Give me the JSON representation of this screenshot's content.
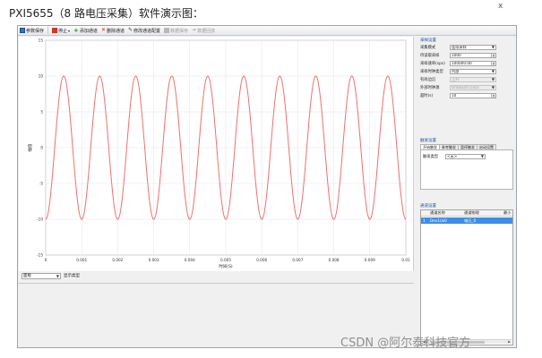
{
  "page_heading": "PXI5655（8 路电压采集）软件演示图：",
  "close_glyph": "x",
  "toolbar": {
    "items": [
      {
        "label": "参数保存",
        "icon": "save-icon"
      },
      {
        "label": "停止",
        "icon": "stop-icon"
      },
      {
        "label": "添加通道",
        "icon": "plus-icon"
      },
      {
        "label": "删除通道",
        "icon": "delete-icon"
      },
      {
        "label": "修改通道配置",
        "icon": "edit-icon"
      },
      {
        "label": "数据保存",
        "icon": "save-disabled-icon"
      },
      {
        "label": "数据回放",
        "icon": "playback-icon"
      }
    ]
  },
  "chart_data": {
    "type": "line",
    "title": "",
    "xlabel": "时间(S)",
    "ylabel": "幅值",
    "xlim": [
      0,
      0.01
    ],
    "ylim": [
      -15,
      15
    ],
    "x_ticks": [
      "0",
      "0.001",
      "0.002",
      "0.003",
      "0.004",
      "0.005",
      "0.006",
      "0.007",
      "0.008",
      "0.009",
      "0.01"
    ],
    "y_ticks": [
      "-15",
      "-10",
      "-5",
      "0",
      "5",
      "10",
      "15"
    ],
    "grid": true,
    "series": [
      {
        "amplitude": 10,
        "frequency_hz": 1000,
        "phase": "-cos",
        "color": "#f07070"
      }
    ]
  },
  "bottom_controls": {
    "select_value": "面板",
    "label": "显示类型"
  },
  "side_panel": {
    "section1_title": "采样设置",
    "rows": [
      {
        "label": "采集模式",
        "value": "连续采样",
        "type": "select",
        "disabled": false
      },
      {
        "label": "待读取采样",
        "value": "1000",
        "type": "spin",
        "disabled": false
      },
      {
        "label": "采样速率(sps)",
        "value": "100000.00",
        "type": "spin",
        "disabled": false
      },
      {
        "label": "采样时钟类型",
        "value": "内部",
        "type": "select",
        "disabled": false
      },
      {
        "label": "有效边沿",
        "value": "上升",
        "type": "select",
        "disabled": true
      },
      {
        "label": "外部时钟源",
        "value": "Onboard Clock",
        "type": "select",
        "disabled": true
      },
      {
        "label": "超时(s)",
        "value": "10",
        "type": "spin",
        "disabled": false
      }
    ],
    "section2_title": "触发设置",
    "tabs": [
      "开始触发",
      "参考触发",
      "暂停触发",
      "启动设置"
    ],
    "trigger_type_label": "触发类型",
    "trigger_type_value": "<无>",
    "section3_title": "通道设置",
    "table": {
      "columns": [
        "",
        "通道名称",
        "通道物理",
        "最小"
      ],
      "rows": [
        [
          "1",
          "Dev1/ai0",
          "电压_0",
          ""
        ]
      ]
    }
  },
  "watermark": "CSDN @阿尔泰科技官方"
}
